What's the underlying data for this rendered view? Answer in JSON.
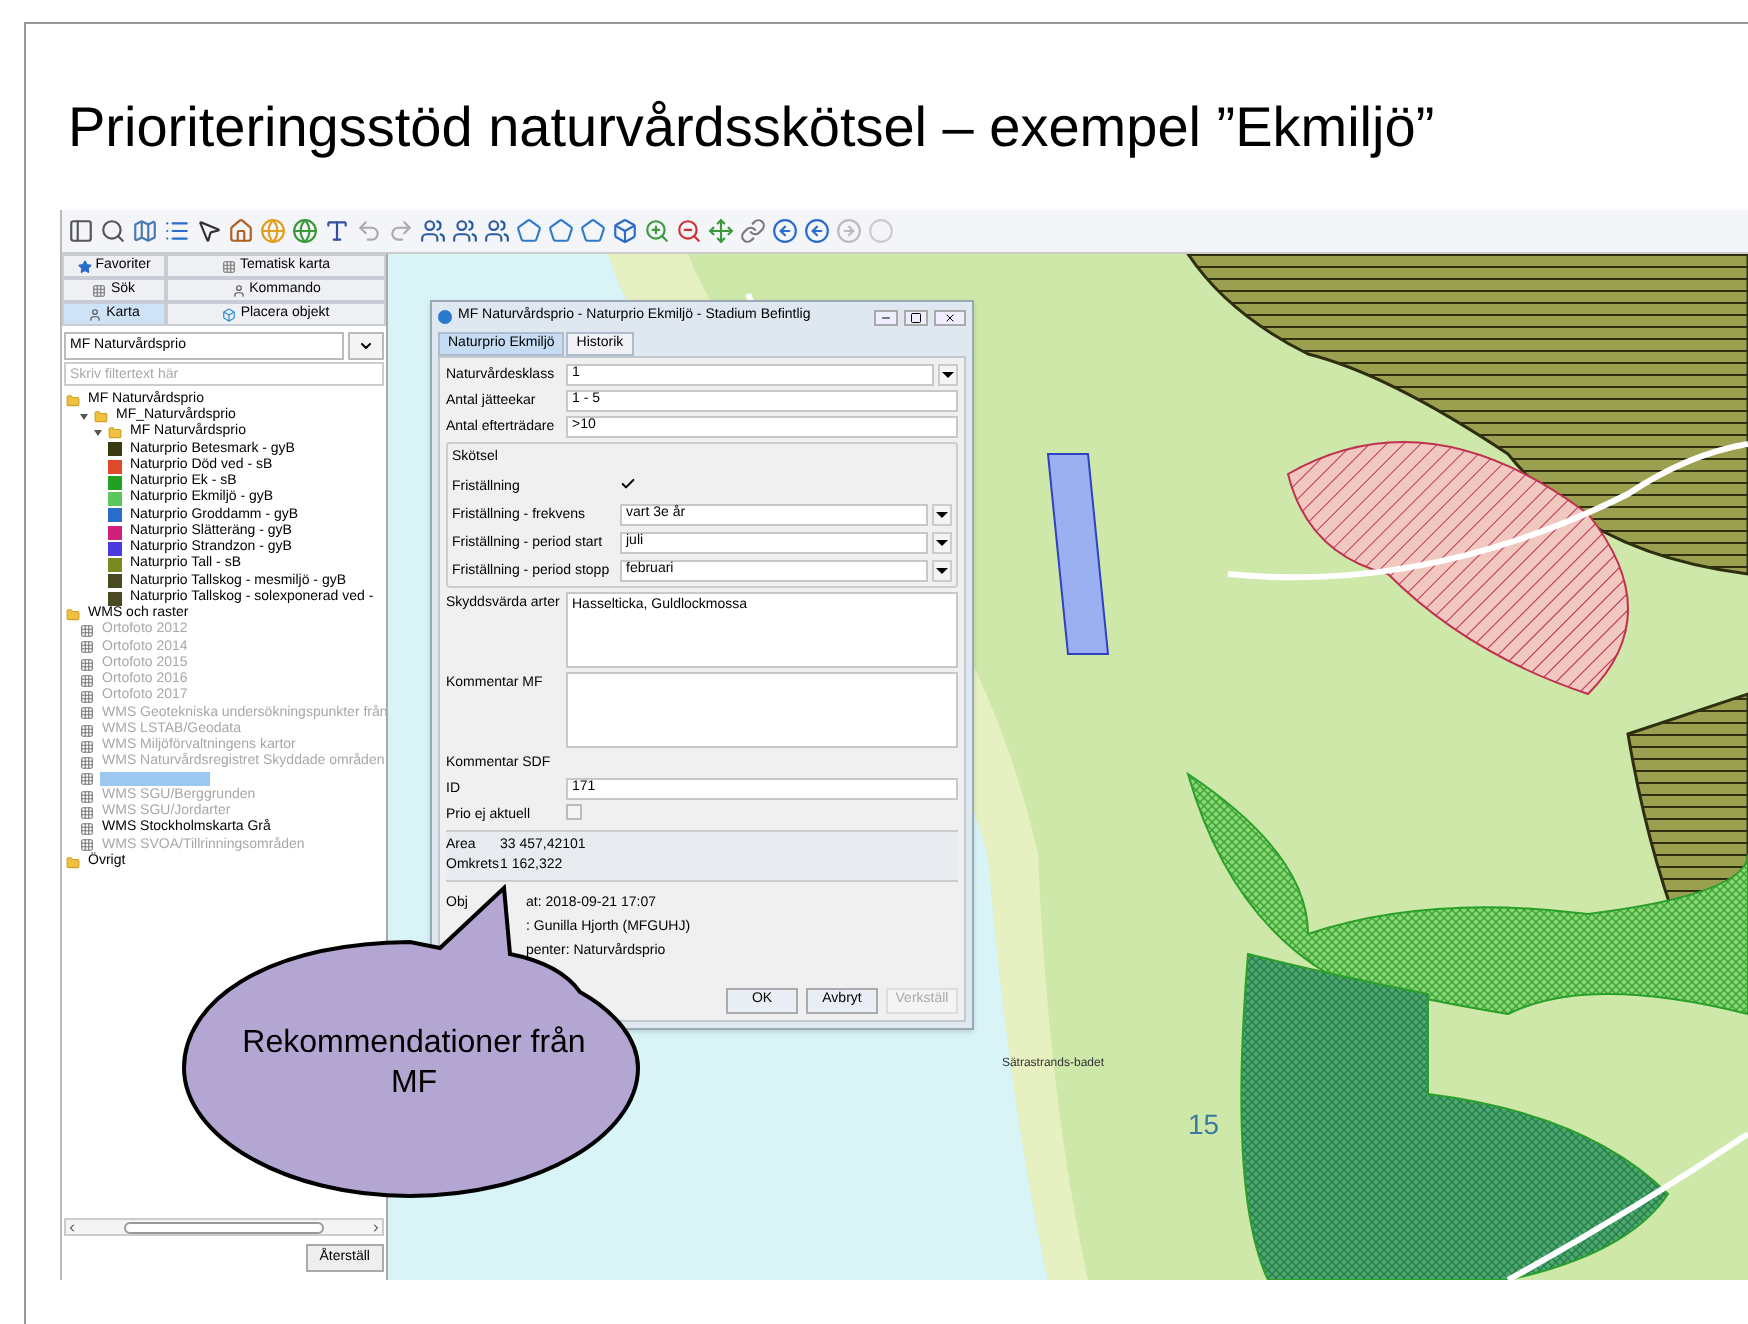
{
  "slide": {
    "title": "Prioriteringsstöd naturvårdsskötsel – exempel ”Ekmiljö”"
  },
  "left_panel": {
    "tabs": [
      {
        "label": "Favoriter",
        "selected": false
      },
      {
        "label": "Tematisk karta",
        "selected": false
      },
      {
        "label": "Sök",
        "selected": false
      },
      {
        "label": "Kommando",
        "selected": false
      },
      {
        "label": "Karta",
        "selected": true
      },
      {
        "label": "Placera objekt",
        "selected": false
      }
    ],
    "layer_select": {
      "value": "MF Naturvårdsprio"
    },
    "filter": {
      "placeholder": "Skriv filtertext här"
    },
    "tree": [
      {
        "label": "MF Naturvårdsprio",
        "kind": "folder",
        "children": [
          {
            "label": "MF_Naturvårdsprio",
            "kind": "folder",
            "children": [
              {
                "label": "MF Naturvårdsprio",
                "kind": "folder",
                "children": [
                  {
                    "label": "Naturprio Betesmark - gyB",
                    "kind": "layer",
                    "color": "#3a3a12"
                  },
                  {
                    "label": "Naturprio Död ved - sB",
                    "kind": "layer",
                    "color": "#e0482a"
                  },
                  {
                    "label": "Naturprio Ek - sB",
                    "kind": "layer",
                    "color": "#22a022"
                  },
                  {
                    "label": "Naturprio Ekmiljö - gyB",
                    "kind": "layer",
                    "color": "#5cc85c"
                  },
                  {
                    "label": "Naturprio Groddamm - gyB",
                    "kind": "layer",
                    "color": "#2a6ccc"
                  },
                  {
                    "label": "Naturprio Slätteräng - gyB",
                    "kind": "layer",
                    "color": "#d0207a"
                  },
                  {
                    "label": "Naturprio Strandzon - gyB",
                    "kind": "layer",
                    "color": "#4a3ae0"
                  },
                  {
                    "label": "Naturprio Tall - sB",
                    "kind": "layer",
                    "color": "#7a8a20"
                  },
                  {
                    "label": "Naturprio Tallskog - mesmiljö - gyB",
                    "kind": "layer",
                    "color": "#4a4a22"
                  },
                  {
                    "label": "Naturprio Tallskog - solexponerad ved -",
                    "kind": "layer",
                    "color": "#4a4a22"
                  }
                ]
              }
            ]
          }
        ]
      },
      {
        "label": "WMS och raster",
        "kind": "folder",
        "children": [
          {
            "label": "Ortofoto 2012",
            "kind": "raster",
            "dimmed": true,
            "selected": false
          },
          {
            "label": "Ortofoto 2014",
            "kind": "raster",
            "dimmed": true,
            "selected": false
          },
          {
            "label": "Ortofoto 2015",
            "kind": "raster",
            "dimmed": true,
            "selected": false
          },
          {
            "label": "Ortofoto 2016",
            "kind": "raster",
            "dimmed": true,
            "selected": false
          },
          {
            "label": "Ortofoto 2017",
            "kind": "raster",
            "dimmed": true,
            "selected": false
          },
          {
            "label": "WMS Geotekniska undersökningspunkter från",
            "kind": "raster",
            "dimmed": true,
            "selected": false
          },
          {
            "label": "WMS LSTAB/Geodata",
            "kind": "raster",
            "dimmed": true,
            "selected": false
          },
          {
            "label": "WMS Miljöförvaltningens kartor",
            "kind": "raster",
            "dimmed": true,
            "selected": false
          },
          {
            "label": "WMS Naturvårdsregistret Skyddade områden",
            "kind": "raster",
            "dimmed": true,
            "selected": false
          },
          {
            "kind": "raster",
            "selected": true
          },
          {
            "label": "WMS SGU/Berggrunden",
            "kind": "raster",
            "dimmed": true,
            "selected": false
          },
          {
            "label": "WMS SGU/Jordarter",
            "kind": "raster",
            "dimmed": true,
            "selected": false
          },
          {
            "label": "WMS Stockholmskarta Grå",
            "kind": "raster",
            "dimmed": false,
            "selected": false
          },
          {
            "label": "WMS SVOA/Tillrinningsområden",
            "kind": "raster",
            "dimmed": true,
            "selected": false
          }
        ]
      },
      {
        "label": "Övrigt",
        "kind": "folder"
      }
    ],
    "reset_button": "Återställ"
  },
  "dialog": {
    "title": "MF Naturvårdsprio - Naturprio Ekmiljö - Stadium Befintlig",
    "tabs": [
      {
        "label": "Naturprio Ekmiljö",
        "selected": true
      },
      {
        "label": "Historik",
        "selected": false
      }
    ],
    "fields": [
      {
        "label": "Naturvårdesklass",
        "kind": "dropdown",
        "value": "1"
      },
      {
        "label": "Antal jätteekar",
        "kind": "text",
        "value": "1 - 5"
      },
      {
        "label": "Antal efterträdare",
        "kind": "text",
        "value": ">10"
      }
    ],
    "group": {
      "title": "Skötsel",
      "fields": [
        {
          "label": "Friställning",
          "kind": "checkbox",
          "checked": true
        },
        {
          "label": "Friställning - frekvens",
          "kind": "dropdown",
          "value": "vart 3e år"
        },
        {
          "label": "Friställning - period start",
          "kind": "dropdown",
          "value": "juli"
        },
        {
          "label": "Friställning - period stopp",
          "kind": "dropdown",
          "value": "februari"
        }
      ]
    },
    "fields2": [
      {
        "label": "Skyddsvärda arter",
        "kind": "textarea",
        "value": "Hasselticka, Guldlockmossa"
      },
      {
        "label": "Kommentar MF",
        "kind": "textarea"
      },
      {
        "label": "Kommentar SDF",
        "kind": "label"
      },
      {
        "label": "ID",
        "kind": "text",
        "value": "171"
      },
      {
        "label": "Prio ej aktuell",
        "kind": "checkbox",
        "checked": false
      }
    ],
    "measures": [
      {
        "label": "Area",
        "value": "33 457,42101"
      },
      {
        "label": "Omkrets",
        "value": "1 162,322"
      }
    ],
    "info": [
      {
        "lead": "Obj",
        "text": "at: 2018-09-21 17:07"
      },
      {
        "text": ": Gunilla Hjorth (MFGUHJ)"
      },
      {
        "text": "penter: Naturvårdsprio"
      }
    ],
    "buttons": [
      {
        "label": "OK",
        "disabled": false
      },
      {
        "label": "Avbryt",
        "disabled": false
      },
      {
        "label": "Verkställ",
        "disabled": true
      }
    ]
  },
  "map": {
    "labels": [
      {
        "text": "Sätrastrands-badet",
        "kind": "place"
      },
      {
        "text": "15",
        "kind": "number"
      }
    ]
  },
  "callout": {
    "text": "Rekommendationer från MF"
  }
}
